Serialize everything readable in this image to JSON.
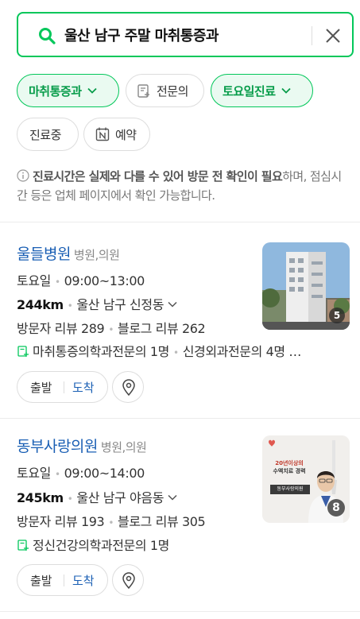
{
  "search": {
    "query": "울산 남구 주말 마취통증과"
  },
  "filters": [
    {
      "label": "마취통증과",
      "active": true
    },
    {
      "label": "전문의",
      "active": false
    },
    {
      "label": "토요일진료",
      "active": true
    },
    {
      "label": "진료중",
      "active": false
    },
    {
      "label": "예약",
      "active": false
    }
  ],
  "notice": {
    "bold_part": "진료시간은 실제와 다를 수 있어 방문 전 확인이 필요",
    "rest": "하며, 점심시간 등은 업체 페이지에서 확인 가능합니다."
  },
  "results": [
    {
      "name": "울들병원",
      "category": "병원,의원",
      "day": "토요일",
      "hours": "09:00~13:00",
      "distance": "244km",
      "address": "울산 남구 신정동",
      "visitor_reviews": "방문자 리뷰 289",
      "blog_reviews": "블로그 리뷰 262",
      "specialists": "마취통증의학과전문의 1명",
      "specialists_more": "신경외과전문의 4명 …",
      "photo_count": "5",
      "depart_label": "출발",
      "arrive_label": "도착"
    },
    {
      "name": "동부사랑의원",
      "category": "병원,의원",
      "day": "토요일",
      "hours": "09:00~14:00",
      "distance": "245km",
      "address": "울산 남구 야음동",
      "visitor_reviews": "방문자 리뷰 193",
      "blog_reviews": "블로그 리뷰 305",
      "specialists": "정신건강의학과전문의 1명",
      "photo_count": "8",
      "thumb_text_1": "20년이상의",
      "thumb_text_2": "수액치료 경력",
      "thumb_sign": "동부사랑의원",
      "depart_label": "출발",
      "arrive_label": "도착"
    }
  ],
  "colors": {
    "accent": "#03c75a",
    "link": "#1a5fb4"
  }
}
